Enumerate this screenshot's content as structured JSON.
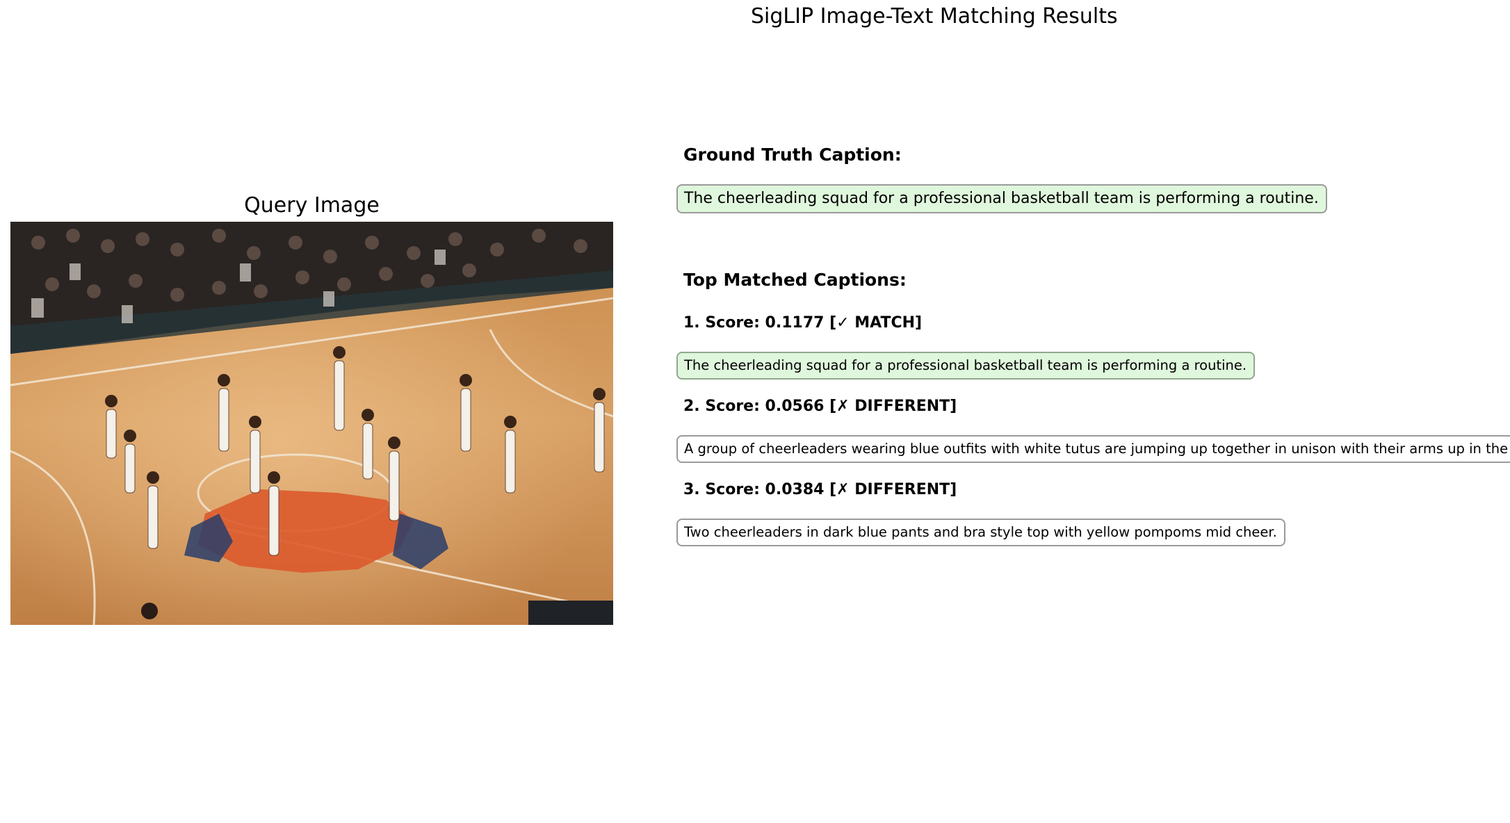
{
  "figure_title": "SigLIP Image-Text Matching Results",
  "query": {
    "title": "Query Image"
  },
  "ground_truth": {
    "heading": "Ground Truth Caption:",
    "caption": "The cheerleading squad for a professional basketball team is performing a routine."
  },
  "top_matches": {
    "heading": "Top Matched Captions:",
    "items": [
      {
        "label": "1. Score: 0.1177 [✓ MATCH]",
        "caption": "The cheerleading squad for a professional basketball team is performing a routine."
      },
      {
        "label": "2. Score: 0.0566 [✗ DIFFERENT]",
        "caption": "A group of cheerleaders wearing blue outfits with white tutus are jumping up together in unison with their arms up in the air."
      },
      {
        "label": "3. Score: 0.0384 [✗ DIFFERENT]",
        "caption": "Two cheerleaders in dark blue pants and bra style top with yellow pompoms mid cheer."
      }
    ]
  },
  "colors": {
    "match_fill": "#dff7dc",
    "box_border": "#9a9a9a"
  }
}
